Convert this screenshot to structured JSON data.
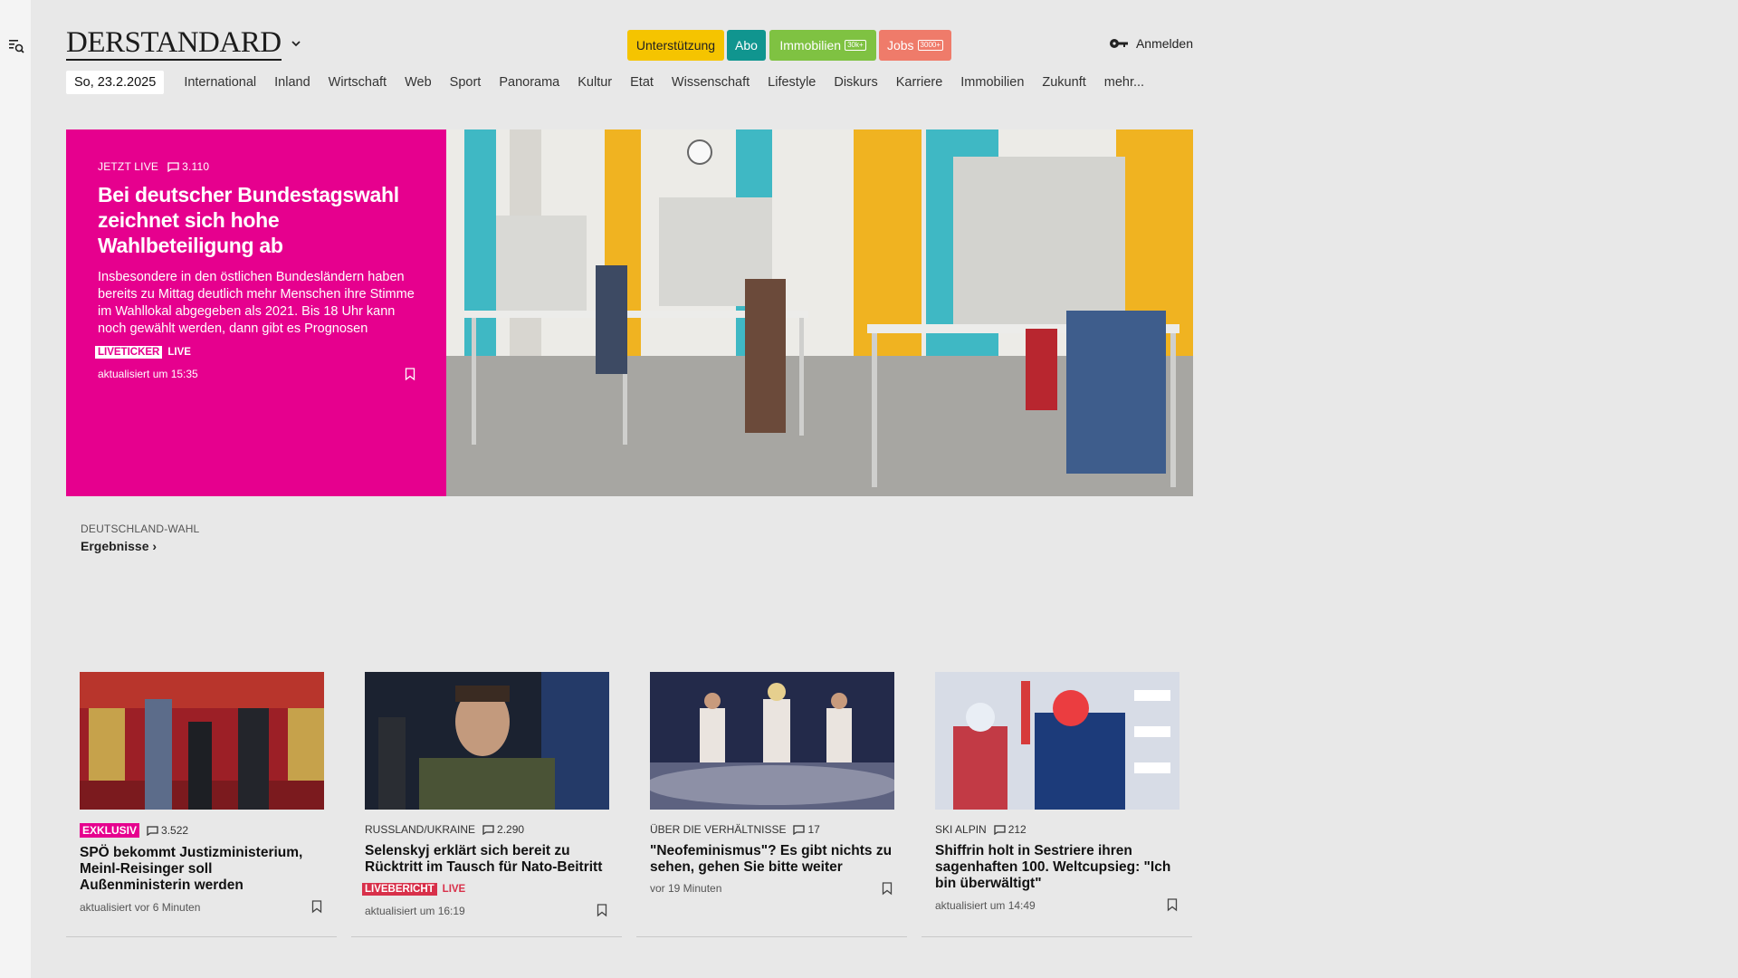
{
  "sidebar": {
    "icon": "search-menu-icon"
  },
  "header": {
    "logo": "DERSTANDARD",
    "buttons": {
      "support": "Unterstützung",
      "abo": "Abo",
      "immobilien": "Immobilien",
      "immobilien_badge": "30k+",
      "jobs": "Jobs",
      "jobs_badge": "3000+"
    },
    "login": "Anmelden"
  },
  "nav": {
    "date": "So, 23.2.2025",
    "items": [
      "International",
      "Inland",
      "Wirtschaft",
      "Web",
      "Sport",
      "Panorama",
      "Kultur",
      "Etat",
      "Wissenschaft",
      "Lifestyle",
      "Diskurs",
      "Karriere",
      "Immobilien",
      "Zukunft",
      "mehr..."
    ]
  },
  "hero": {
    "kicker": "JETZT LIVE",
    "comments": "3.110",
    "title": "Bei deutscher Bundestagswahl zeichnet sich hohe Wahlbeteiligung ab",
    "teaser": "Insbesondere in den östlichen Bundesländern haben bereits zu Mittag deutlich mehr Menschen ihre Stimme im Wahllokal abgegeben als 2021. Bis 18 Uhr kann noch gewählt werden, dann gibt es Prognosen",
    "tag": "LIVETICKER",
    "live": "LIVE",
    "updated": "aktualisiert um 15:35",
    "color": "#e6008e"
  },
  "wahl": {
    "kicker": "DEUTSCHLAND-WAHL",
    "link": "Ergebnisse"
  },
  "cards": [
    {
      "kicker": "EXKLUSIV",
      "comments": "3.522",
      "title": "SPÖ bekommt Justizministerium, Meinl-Reisinger soll Außenministerin werden",
      "updated": "aktualisiert vor 6 Minuten"
    },
    {
      "kicker": "RUSSLAND/UKRAINE",
      "comments": "2.290",
      "title": "Selenskyj erklärt sich bereit zu Rücktritt im Tausch für Nato-Beitritt",
      "tag": "LIVEBERICHT",
      "live": "LIVE",
      "updated": "aktualisiert um 16:19"
    },
    {
      "kicker": "ÜBER DIE VERHÄLTNISSE",
      "comments": "17",
      "title": "\"Neofeminismus\"? Es gibt nichts zu sehen, gehen Sie bitte weiter",
      "updated": "vor 19 Minuten"
    },
    {
      "kicker": "SKI ALPIN",
      "comments": "212",
      "title": "Shiffrin holt in Sestriere ihren sagenhaften 100. Weltcupsieg: \"Ich bin überwältigt\"",
      "updated": "aktualisiert um 14:49"
    }
  ]
}
